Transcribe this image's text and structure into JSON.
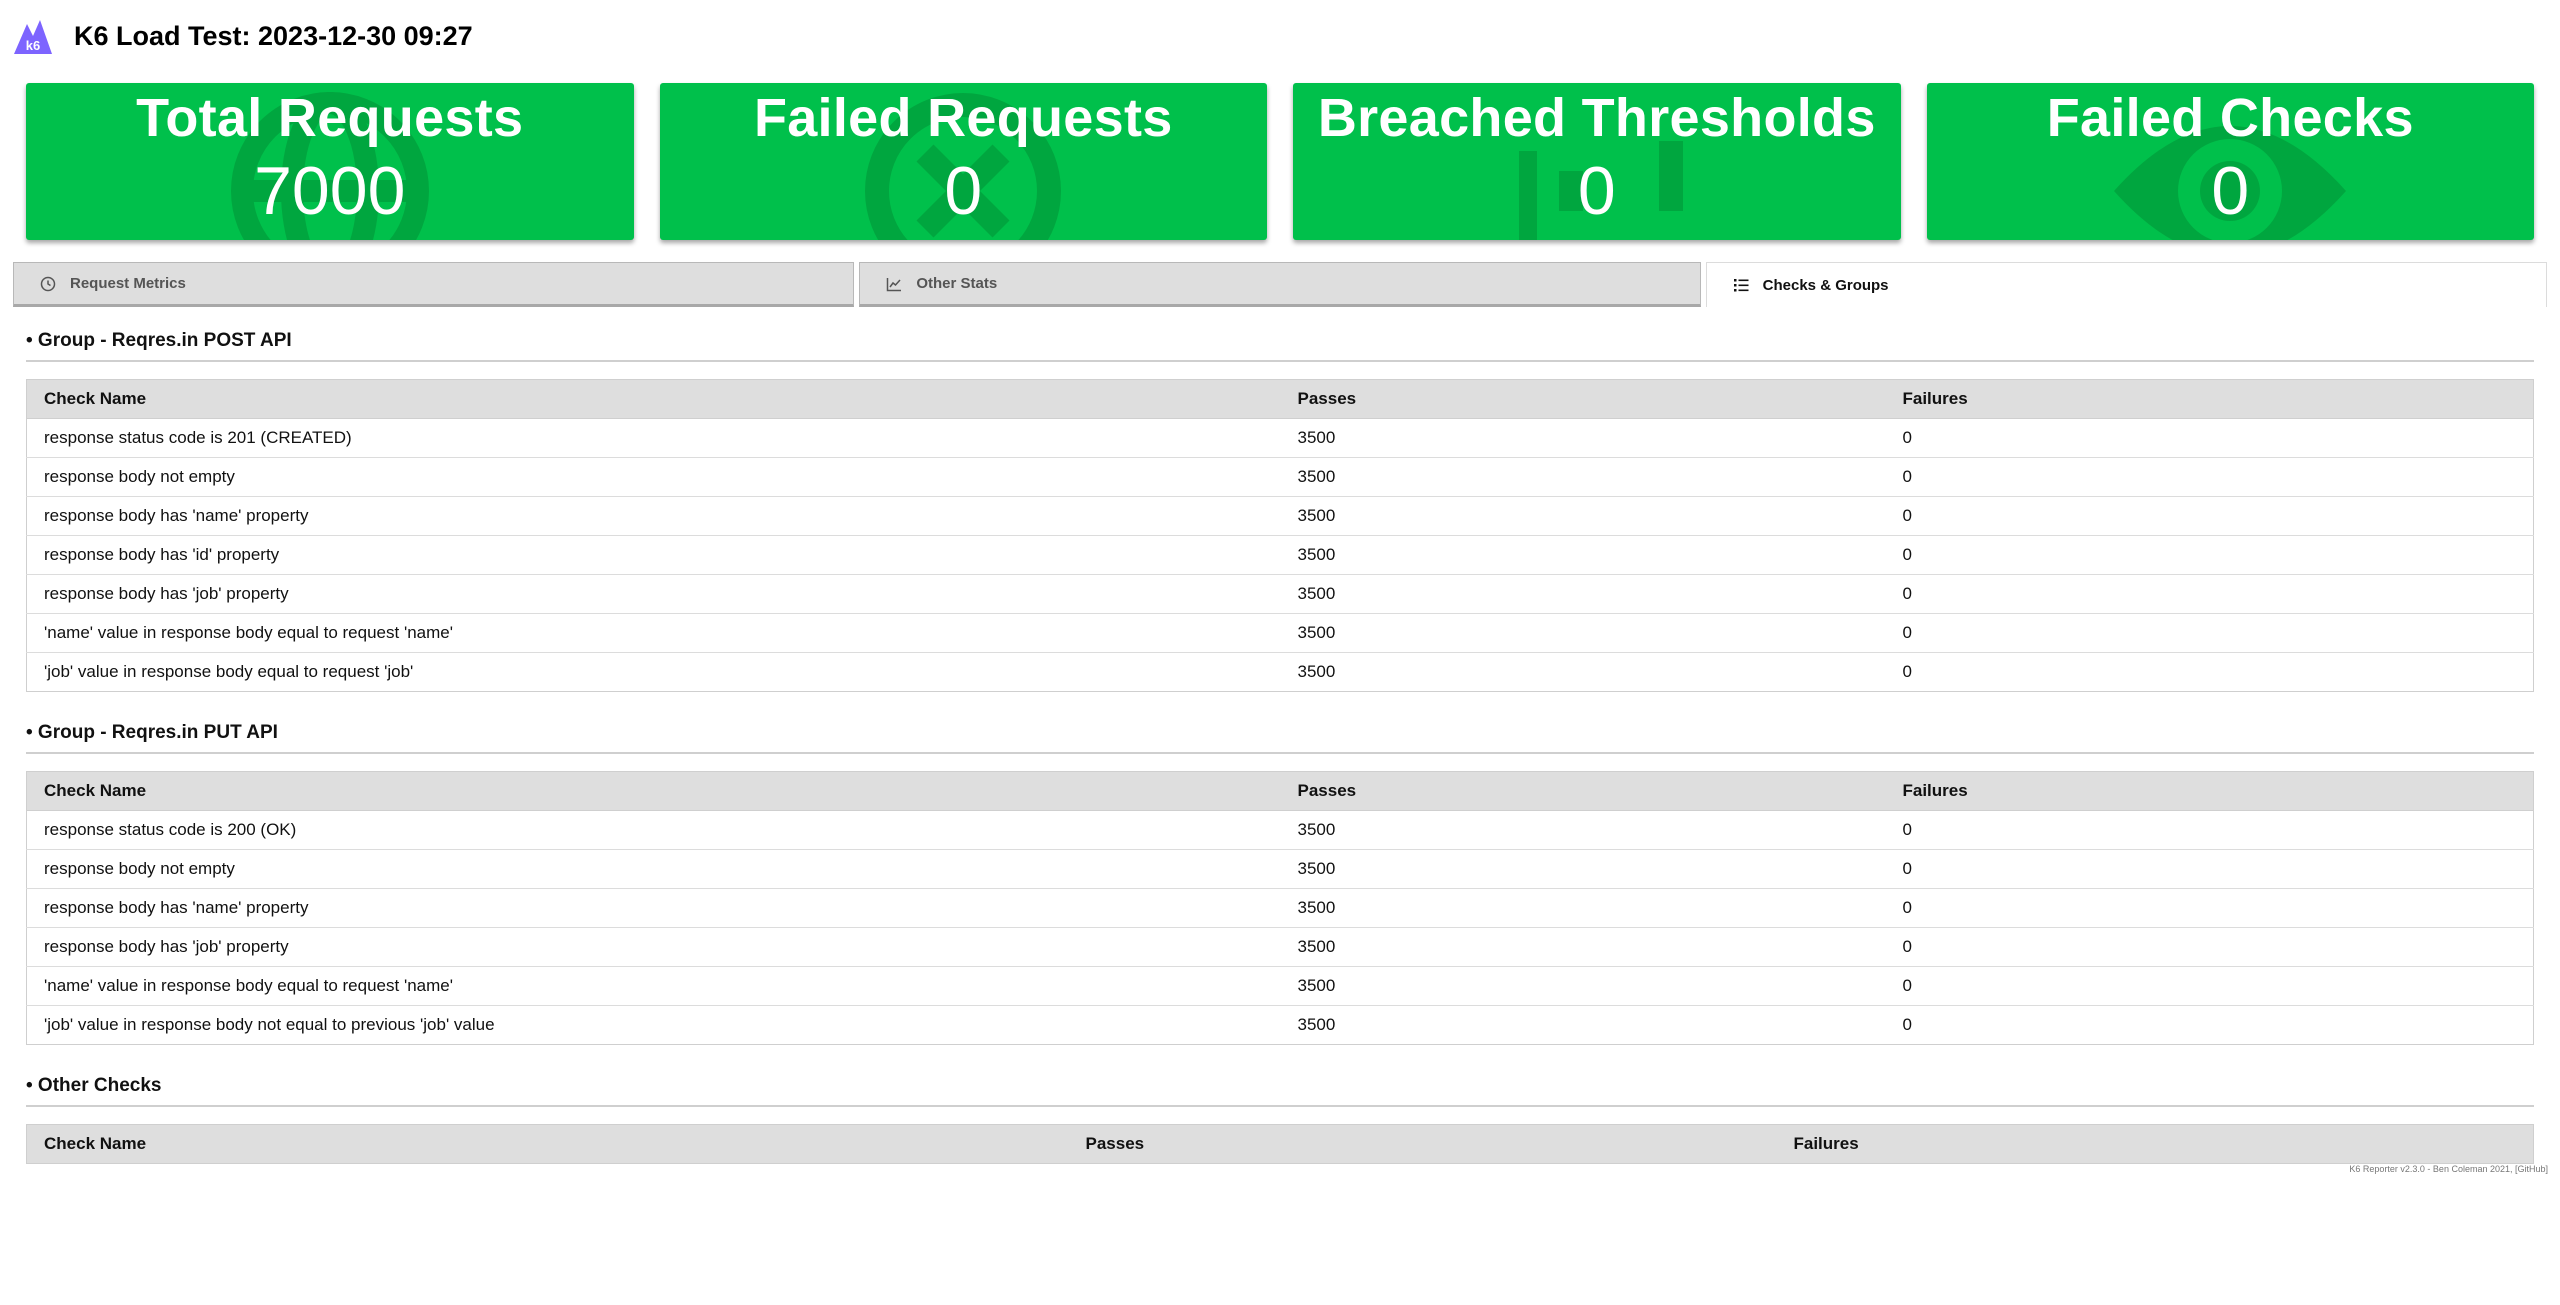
{
  "header": {
    "title": "K6 Load Test: 2023-12-30 09:27",
    "logo_text": "k6",
    "logo_color": "#7d64ff"
  },
  "colors": {
    "box_green": "#00c04b",
    "box_icon": "#00a63f",
    "tab_bg": "#dedede"
  },
  "stats": [
    {
      "title": "Total Requests",
      "value": "7000",
      "icon": "globe-icon"
    },
    {
      "title": "Failed Requests",
      "value": "0",
      "icon": "x-circle-icon"
    },
    {
      "title": "Breached Thresholds",
      "value": "0",
      "icon": "chart-bars-icon"
    },
    {
      "title": "Failed Checks",
      "value": "0",
      "icon": "eye-icon"
    }
  ],
  "tabs": [
    {
      "label": "Request Metrics",
      "icon": "clock-icon",
      "active": false
    },
    {
      "label": "Other Stats",
      "icon": "line-chart-icon",
      "active": false
    },
    {
      "label": "Checks & Groups",
      "icon": "list-check-icon",
      "active": true
    }
  ],
  "groups": [
    {
      "heading": "• Group - Reqres.in POST API",
      "columns": [
        "Check Name",
        "Passes",
        "Failures"
      ],
      "rows": [
        [
          "response status code is 201 (CREATED)",
          "3500",
          "0"
        ],
        [
          "response body not empty",
          "3500",
          "0"
        ],
        [
          "response body has 'name' property",
          "3500",
          "0"
        ],
        [
          "response body has 'id' property",
          "3500",
          "0"
        ],
        [
          "response body has 'job' property",
          "3500",
          "0"
        ],
        [
          "'name' value in response body equal to request 'name'",
          "3500",
          "0"
        ],
        [
          "'job' value in response body equal to request 'job'",
          "3500",
          "0"
        ]
      ]
    },
    {
      "heading": "• Group - Reqres.in PUT API",
      "columns": [
        "Check Name",
        "Passes",
        "Failures"
      ],
      "rows": [
        [
          "response status code is 200 (OK)",
          "3500",
          "0"
        ],
        [
          "response body not empty",
          "3500",
          "0"
        ],
        [
          "response body has 'name' property",
          "3500",
          "0"
        ],
        [
          "response body has 'job' property",
          "3500",
          "0"
        ],
        [
          "'name' value in response body equal to request 'name'",
          "3500",
          "0"
        ],
        [
          "'job' value in response body not equal to previous 'job' value",
          "3500",
          "0"
        ]
      ]
    },
    {
      "heading": "• Other Checks",
      "columns": [
        "Check Name",
        "Passes",
        "Failures"
      ],
      "rows": []
    }
  ],
  "footer": {
    "text": "K6 Reporter v2.3.0 - Ben Coleman 2021, [GitHub]"
  }
}
